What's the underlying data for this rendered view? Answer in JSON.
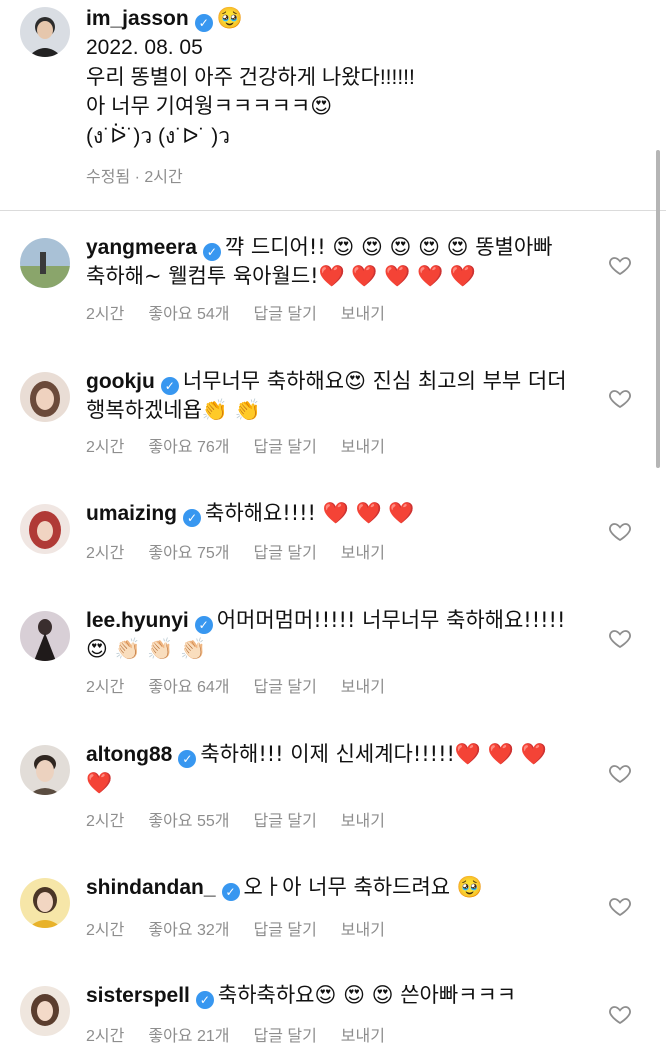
{
  "caption": {
    "username": "im_jasson",
    "verified": true,
    "emoji": "🥹",
    "lines": [
      "2022. 08. 05",
      "우리 똥별이 아주 건강하게 나왔다!!!!!!",
      "아 너무 기여웡ㅋㅋㅋㅋㅋ😍",
      "(ง˙ᐖ˙)ว (ง˙ᐅ˙ )ว"
    ],
    "edited_label": "수정됨 · 2시간"
  },
  "labels": {
    "likes_prefix": "좋아요",
    "reply": "답글 달기",
    "send": "보내기"
  },
  "comments": [
    {
      "username": "yangmeera",
      "text_line1": "꺅 드디어!! 😍 😍 😍 😍 😍 똥별아빠",
      "text_line2": "축하해~ 웰컴투 육아월드!❤️ ❤️ ❤️ ❤️ ❤️",
      "time": "2시간",
      "likes": "좋아요 54개",
      "avatar_color": "#8aa56b"
    },
    {
      "username": "gookju",
      "text_line1": "너무너무 축하해요😍 진심 최고의 부부 더더",
      "text_line2": "행복하겠네욥👏 👏",
      "time": "2시간",
      "likes": "좋아요 76개",
      "avatar_color": "#c9a58d"
    },
    {
      "username": "umaizing",
      "text_line1": "축하해요!!!! ❤️ ❤️ ❤️",
      "text_line2": "",
      "time": "2시간",
      "likes": "좋아요 75개",
      "avatar_color": "#c0504d"
    },
    {
      "username": "lee.hyunyi",
      "text_line1": "어머머멈머!!!!! 너무너무 축하해요!!!!!",
      "text_line2": "😍 👏🏻 👏🏻 👏🏻",
      "time": "2시간",
      "likes": "좋아요 64개",
      "avatar_color": "#b8a3a0"
    },
    {
      "username": "altong88",
      "text_line1": "축하해!!! 이제 신세계다!!!!!❤️ ❤️ ❤️",
      "text_line2": "❤️",
      "time": "2시간",
      "likes": "좋아요 55개",
      "avatar_color": "#9d8e7e"
    },
    {
      "username": "shindandan_",
      "text_line1": "오ㅏ아 너무 축하드려요 🥹",
      "text_line2": "",
      "time": "2시간",
      "likes": "좋아요 32개",
      "avatar_color": "#e8c45a"
    },
    {
      "username": "sisterspell",
      "text_line1": "축하축하요😍 😍 😍 쓴아빠ㅋㅋㅋ",
      "text_line2": "",
      "time": "2시간",
      "likes": "좋아요 21개",
      "avatar_color": "#d2b7a6"
    }
  ]
}
